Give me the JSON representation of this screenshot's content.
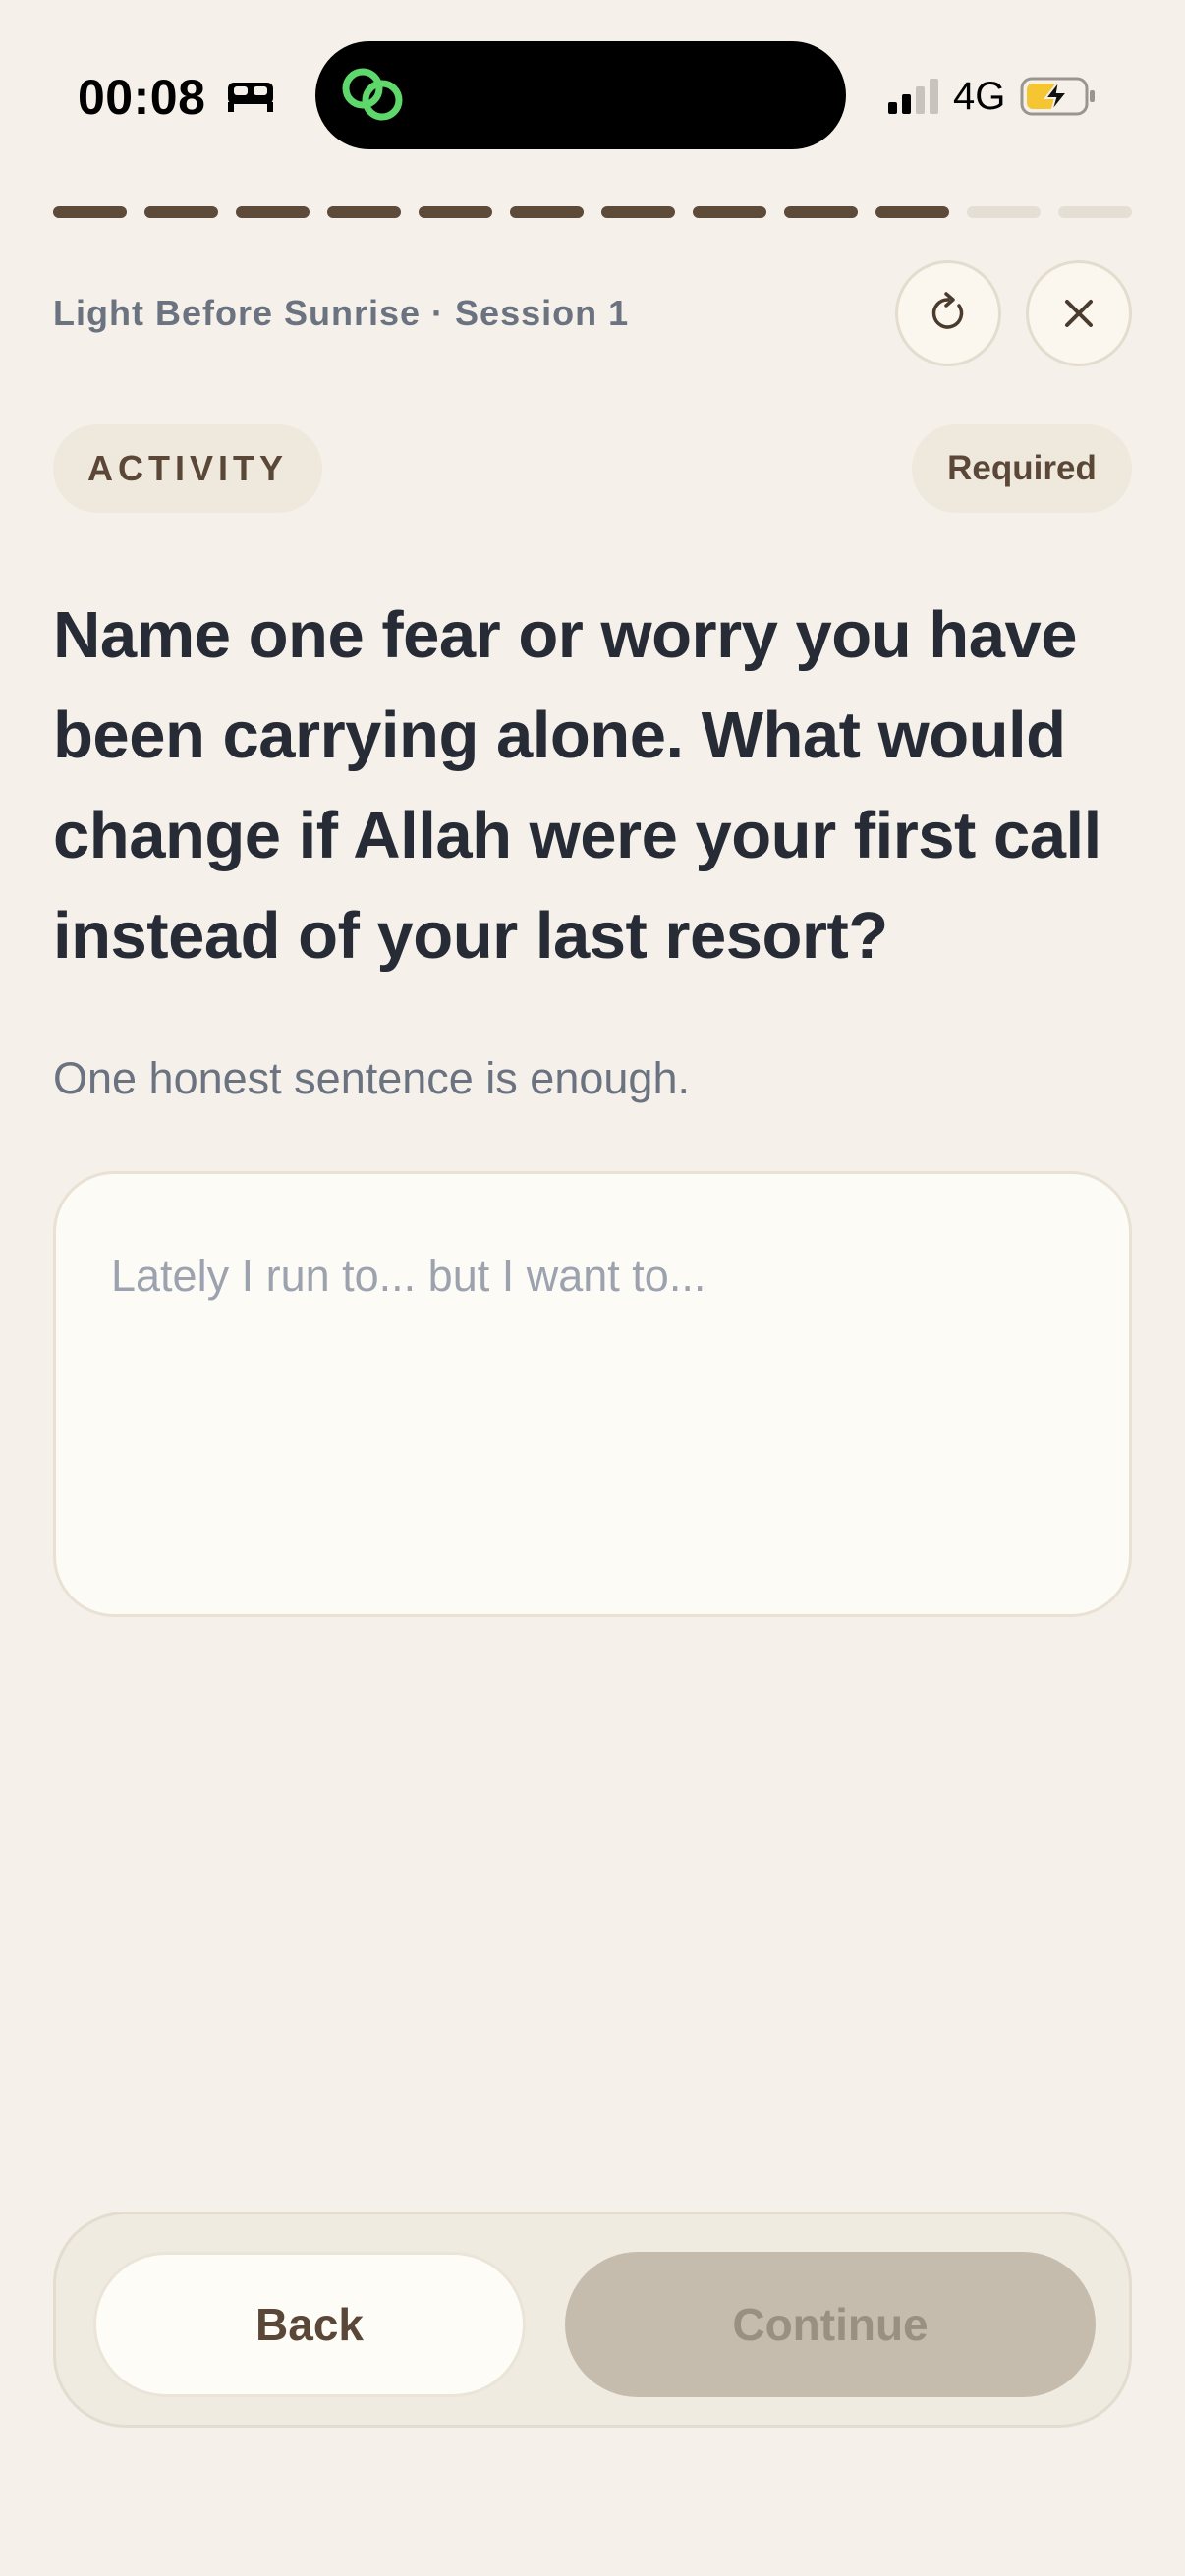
{
  "status_bar": {
    "time": "00:08",
    "network": "4G",
    "icons": [
      "sleep-icon",
      "link-icon",
      "signal-icon",
      "battery-charging-icon"
    ]
  },
  "progress": {
    "total_steps": 12,
    "completed_steps": 10
  },
  "header": {
    "session_title": "Light Before Sunrise · Session 1",
    "restart_icon": "restart-icon",
    "close_icon": "close-icon"
  },
  "tags": {
    "activity": "ACTIVITY",
    "required": "Required"
  },
  "prompt": {
    "question": "Name one fear or worry you have been carrying alone. What would change if Allah were your first call instead of your last resort?",
    "hint": "One honest sentence is enough."
  },
  "answer": {
    "value": "",
    "placeholder": "Lately I run to... but I want to..."
  },
  "actions": {
    "back_label": "Back",
    "continue_label": "Continue",
    "continue_enabled": false
  },
  "colors": {
    "background": "#f5f1ea",
    "accent": "#5e4a39",
    "text": "#262b35",
    "muted": "#6b7280",
    "disabled": "#c5bcae",
    "link_green": "#5fd86b",
    "battery_yellow": "#f5c631"
  }
}
